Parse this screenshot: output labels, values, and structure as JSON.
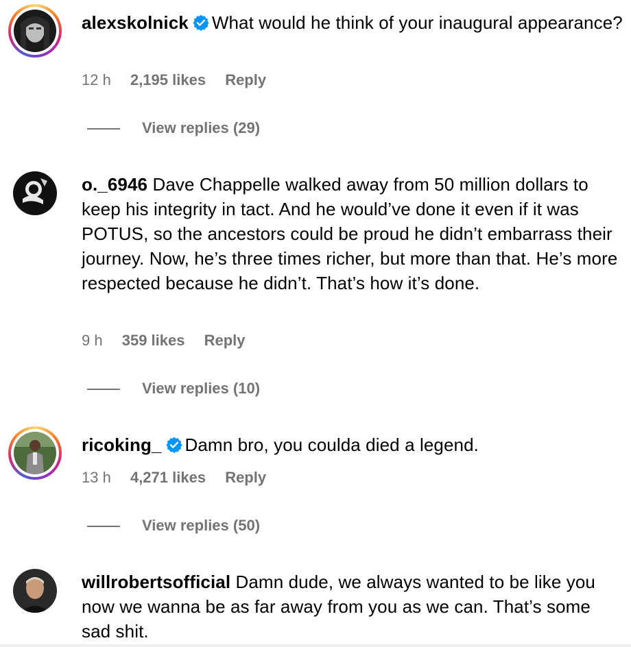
{
  "comments": [
    {
      "username": "alexskolnick",
      "verified": true,
      "text": "What would he think of your inaugural appearance?",
      "time": "12 h",
      "likes": "2,195 likes",
      "reply": "Reply",
      "view_replies": "View replies (29)"
    },
    {
      "username": "o._6946",
      "verified": false,
      "text": "Dave Chappelle walked away from 50 million dollars to keep his integrity in tact. And he would’ve done it even if it was POTUS, so the ancestors could be proud he didn’t embarrass their journey. Now, he’s three times richer, but more than that. He’s more respected because he didn’t. That’s how it’s done.",
      "time": "9 h",
      "likes": "359 likes",
      "reply": "Reply",
      "view_replies": "View replies (10)"
    },
    {
      "username": "ricoking_",
      "verified": true,
      "text": "Damn bro, you coulda died a legend.",
      "time": "13 h",
      "likes": "4,271 likes",
      "reply": "Reply",
      "view_replies": "View replies (50)"
    },
    {
      "username": "willrobertsofficial",
      "verified": false,
      "text": "Damn dude, we always wanted to be like you now we wanna be as far away from you as we can. That’s some sad shit."
    }
  ],
  "colors": {
    "verified_badge": "#0095f6",
    "meta_gray": "#737373"
  },
  "icons": {
    "verified": "verified-badge-icon"
  }
}
